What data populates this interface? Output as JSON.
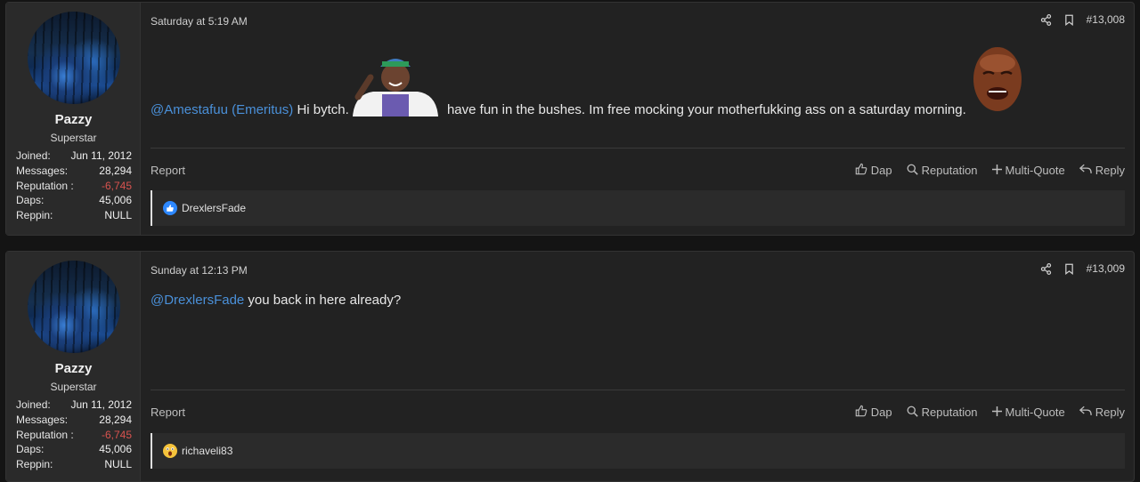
{
  "posts": [
    {
      "user": {
        "name": "Pazzy",
        "title": "Superstar",
        "stats": [
          {
            "label": "Joined:",
            "value": "Jun 11, 2012"
          },
          {
            "label": "Messages:",
            "value": "28,294"
          },
          {
            "label": "Reputation :",
            "value": "-6,745"
          },
          {
            "label": "Daps:",
            "value": "45,006"
          },
          {
            "label": "Reppin:",
            "value": "NULL"
          }
        ]
      },
      "time": "Saturday at 5:19 AM",
      "post_number": "#13,008",
      "content": {
        "mention": "@Amestafuu (Emeritus)",
        "text_a": " Hi bytch. ",
        "text_b": "have fun in the bushes. Im free mocking your motherfukking ass on a saturday morning."
      },
      "reaction": {
        "icon": "like-icon",
        "user": "DrexlersFade"
      }
    },
    {
      "user": {
        "name": "Pazzy",
        "title": "Superstar",
        "stats": [
          {
            "label": "Joined:",
            "value": "Jun 11, 2012"
          },
          {
            "label": "Messages:",
            "value": "28,294"
          },
          {
            "label": "Reputation :",
            "value": "-6,745"
          },
          {
            "label": "Daps:",
            "value": "45,006"
          },
          {
            "label": "Reppin:",
            "value": "NULL"
          }
        ]
      },
      "time": "Sunday at 12:13 PM",
      "post_number": "#13,009",
      "content": {
        "mention": "@DrexlersFade",
        "text_a": " you back in here already?"
      },
      "reaction": {
        "icon": "wow-icon",
        "user": "richaveli83"
      }
    }
  ],
  "actions": {
    "report": "Report",
    "dap": "Dap",
    "reputation": "Reputation",
    "multiquote": "Multi-Quote",
    "reply": "Reply"
  },
  "colors": {
    "mention": "#4a90d9",
    "negative": "#d9534f",
    "like": "#2d88ff",
    "wow": "#f5c33b"
  }
}
